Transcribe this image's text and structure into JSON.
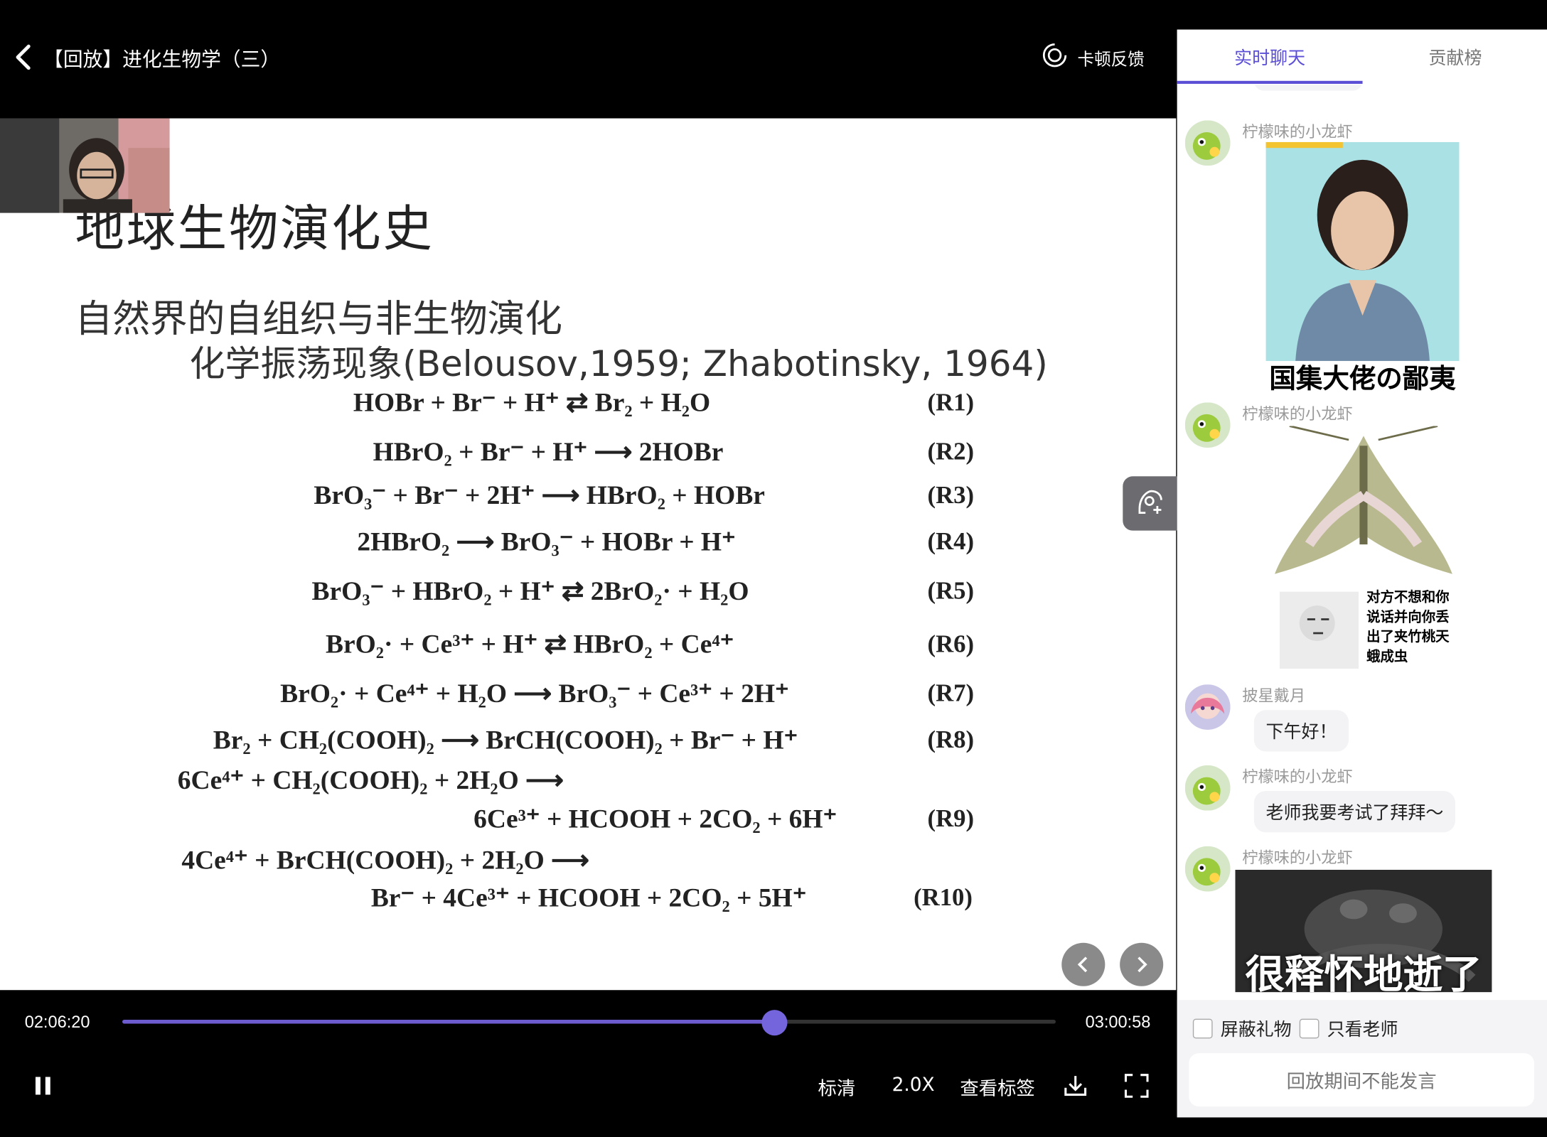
{
  "header": {
    "title": "【回放】进化生物学（三）",
    "feedback_label": "卡顿反馈"
  },
  "slide": {
    "title": "地球生物演化史",
    "subtitle": "自然界的自组织与非生物演化",
    "subtitle2": "化学振荡现象(Belousov,1959; Zhabotinsky, 1964)",
    "reactions": [
      {
        "eq": "HOBr + Br⁻ + H⁺ ⇄ Br₂ + H₂O",
        "label": "(R1)"
      },
      {
        "eq": "HBrO₂ + Br⁻ + H⁺ ⟶ 2HOBr",
        "label": "(R2)"
      },
      {
        "eq": "BrO₃⁻ + Br⁻ + 2H⁺ ⟶ HBrO₂ + HOBr",
        "label": "(R3)"
      },
      {
        "eq": "2HBrO₂ ⟶ BrO₃⁻ + HOBr + H⁺",
        "label": "(R4)"
      },
      {
        "eq": "BrO₃⁻ + HBrO₂ + H⁺ ⇄ 2BrO₂· + H₂O",
        "label": "(R5)"
      },
      {
        "eq": "BrO₂· + Ce³⁺ + H⁺ ⇄ HBrO₂ + Ce⁴⁺",
        "label": "(R6)"
      },
      {
        "eq": "BrO₂· + Ce⁴⁺ + H₂O ⟶ BrO₃⁻ + Ce³⁺ + 2H⁺",
        "label": "(R7)"
      },
      {
        "eq": "Br₂ + CH₂(COOH)₂ ⟶ BrCH(COOH)₂ + Br⁻ + H⁺",
        "label": "(R8)"
      },
      {
        "eq": "6Ce⁴⁺ + CH₂(COOH)₂ + 2H₂O ⟶",
        "label": ""
      },
      {
        "eq": "6Ce³⁺ + HCOOH + 2CO₂ + 6H⁺",
        "label": "(R9)"
      },
      {
        "eq": "4Ce⁴⁺ + BrCH(COOH)₂ + 2H₂O ⟶",
        "label": ""
      },
      {
        "eq": "Br⁻ + 4Ce³⁺ + HCOOH + 2CO₂ + 5H⁺",
        "label": "(R10)"
      }
    ]
  },
  "player": {
    "current_time": "02:06:20",
    "total_time": "03:00:58",
    "progress_fraction": 0.6989,
    "quality_label": "标清",
    "speed_label": "2.0X",
    "bookmarks_label": "查看标签",
    "accent_color": "#6d5bd0"
  },
  "panel": {
    "tabs": [
      {
        "label": "实时聊天",
        "active": true
      },
      {
        "label": "贡献榜",
        "active": false
      }
    ],
    "messages": [
      {
        "user": "柠檬味的小龙虾",
        "type": "image",
        "caption": "国集大佬の鄙夷"
      },
      {
        "user": "柠檬味的小龙虾",
        "type": "image",
        "caption": "对方不想和你说话并向你丢出了夹竹桃天蛾成虫"
      },
      {
        "user": "披星戴月",
        "type": "text",
        "text": "下午好！"
      },
      {
        "user": "柠檬味的小龙虾",
        "type": "text",
        "text": "老师我要考试了拜拜～"
      },
      {
        "user": "柠檬味的小龙虾",
        "type": "image",
        "caption": "很释怀地逝了"
      }
    ],
    "options": [
      {
        "label": "屏蔽礼物",
        "checked": false
      },
      {
        "label": "只看老师",
        "checked": false
      }
    ],
    "input_disabled_text": "回放期间不能发言"
  }
}
